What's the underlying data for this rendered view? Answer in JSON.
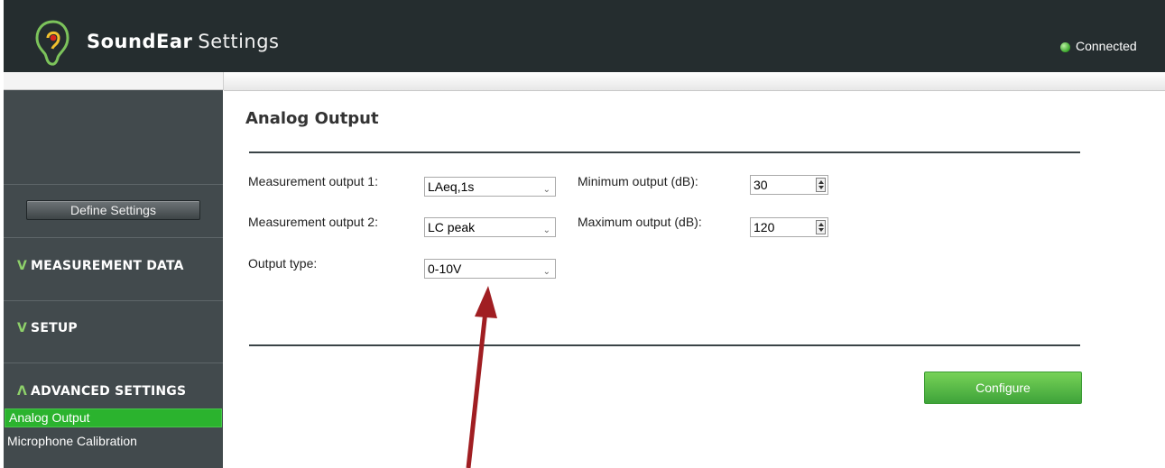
{
  "app": {
    "brand_bold": "SoundEar",
    "brand_light": "Settings",
    "status": "Connected",
    "status_color": "#39a52a"
  },
  "sidebar": {
    "define_button": "Define Settings",
    "sections": [
      {
        "chevron": "V",
        "label": "MEASUREMENT DATA",
        "expanded": false
      },
      {
        "chevron": "V",
        "label": "SETUP",
        "expanded": false
      },
      {
        "chevron": "Λ",
        "label": "ADVANCED SETTINGS",
        "expanded": true
      }
    ],
    "items": [
      {
        "label": "Analog Output",
        "active": true
      },
      {
        "label": "Microphone Calibration",
        "active": false
      }
    ]
  },
  "main": {
    "title": "Analog Output",
    "fields": {
      "measurement_output_1": {
        "label": "Measurement output 1:",
        "value": "LAeq,1s"
      },
      "measurement_output_2": {
        "label": "Measurement output 2:",
        "value": "LC peak"
      },
      "output_type": {
        "label": "Output type:",
        "value": "0-10V"
      },
      "minimum_output": {
        "label": "Minimum output (dB):",
        "value": "30"
      },
      "maximum_output": {
        "label": "Maximum output (dB):",
        "value": "120"
      }
    },
    "configure_button": "Configure"
  },
  "annotation": {
    "icon": "red-arrow-icon",
    "color": "#a01e22"
  },
  "colors": {
    "header_bg": "#252d2f",
    "sidebar_bg": "#424a4d",
    "accent_green": "#2bb32e"
  }
}
